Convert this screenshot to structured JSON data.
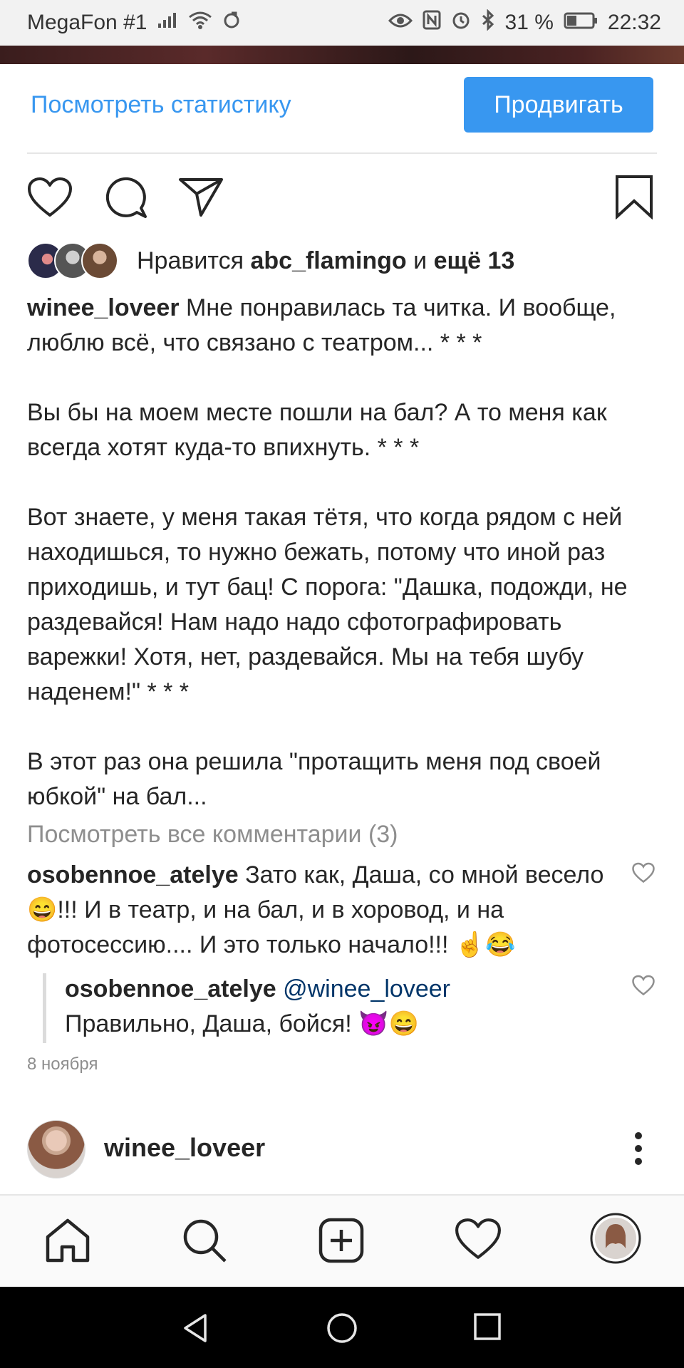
{
  "status_bar": {
    "carrier": "MegaFon #1",
    "battery": "31 %",
    "time": "22:32",
    "icons": [
      "signal-icon",
      "wifi-icon",
      "sync-icon",
      "eye-icon",
      "nfc-icon",
      "alarm-icon",
      "bluetooth-icon",
      "battery-icon"
    ]
  },
  "post_actions": {
    "stats_label": "Посмотреть статистику",
    "promote_label": "Продвигать"
  },
  "likes": {
    "prefix": "Нравится",
    "user": "abc_flamingo",
    "middle": "и",
    "rest": "ещё 13"
  },
  "caption": {
    "username": "winee_loveer",
    "p1": "Мне понравилась та читка. И вообще, люблю всё, что связано с театром... * * *",
    "p2": "Вы бы на моем месте пошли на бал? А то меня как всегда хотят куда-то впихнуть. * * *",
    "p3": "Вот знаете, у меня такая тётя, что когда рядом с ней находишься, то нужно бежать, потому что иной раз приходишь, и тут бац! С порога: \"Дашка, подожди, не раздевайся! Нам надо надо сфотографировать варежки! Хотя, нет, раздевайся. Мы на тебя шубу наденем!\" * * *",
    "p4": "В этот раз она решила \"протащить меня под своей юбкой\" на бал..."
  },
  "view_all_comments": "Посмотреть все комментарии (3)",
  "comments": [
    {
      "username": "osobennoe_atelye",
      "text_a": "Зато как, Даша, со мной весело",
      "emoji_a": "😄",
      "text_b": "!!! И в театр, и на бал, и в хоровод, и на фотосессию.... И это только начало!!!",
      "emoji_b": "☝😂"
    },
    {
      "username": "osobennoe_atelye",
      "mention": "@winee_loveer",
      "text": "Правильно, Даша, бойся!",
      "emoji": "😈😄"
    }
  ],
  "post_date": "8 ноября",
  "next_post": {
    "username": "winee_loveer"
  },
  "colors": {
    "accent": "#3897f0",
    "text": "#262626",
    "muted": "#8e8e8e"
  }
}
